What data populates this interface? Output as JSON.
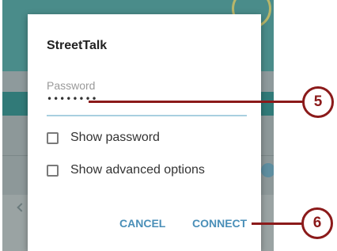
{
  "dialog": {
    "title": "StreetTalk",
    "password_label": "Password",
    "password_value": "••••••••",
    "show_password_label": "Show password",
    "show_advanced_label": "Show advanced options",
    "cancel_label": "CANCEL",
    "connect_label": "CONNECT"
  },
  "callouts": {
    "password": "5",
    "connect": "6"
  },
  "colors": {
    "accent": "#4a8fb8",
    "callout": "#8b1a1a"
  }
}
